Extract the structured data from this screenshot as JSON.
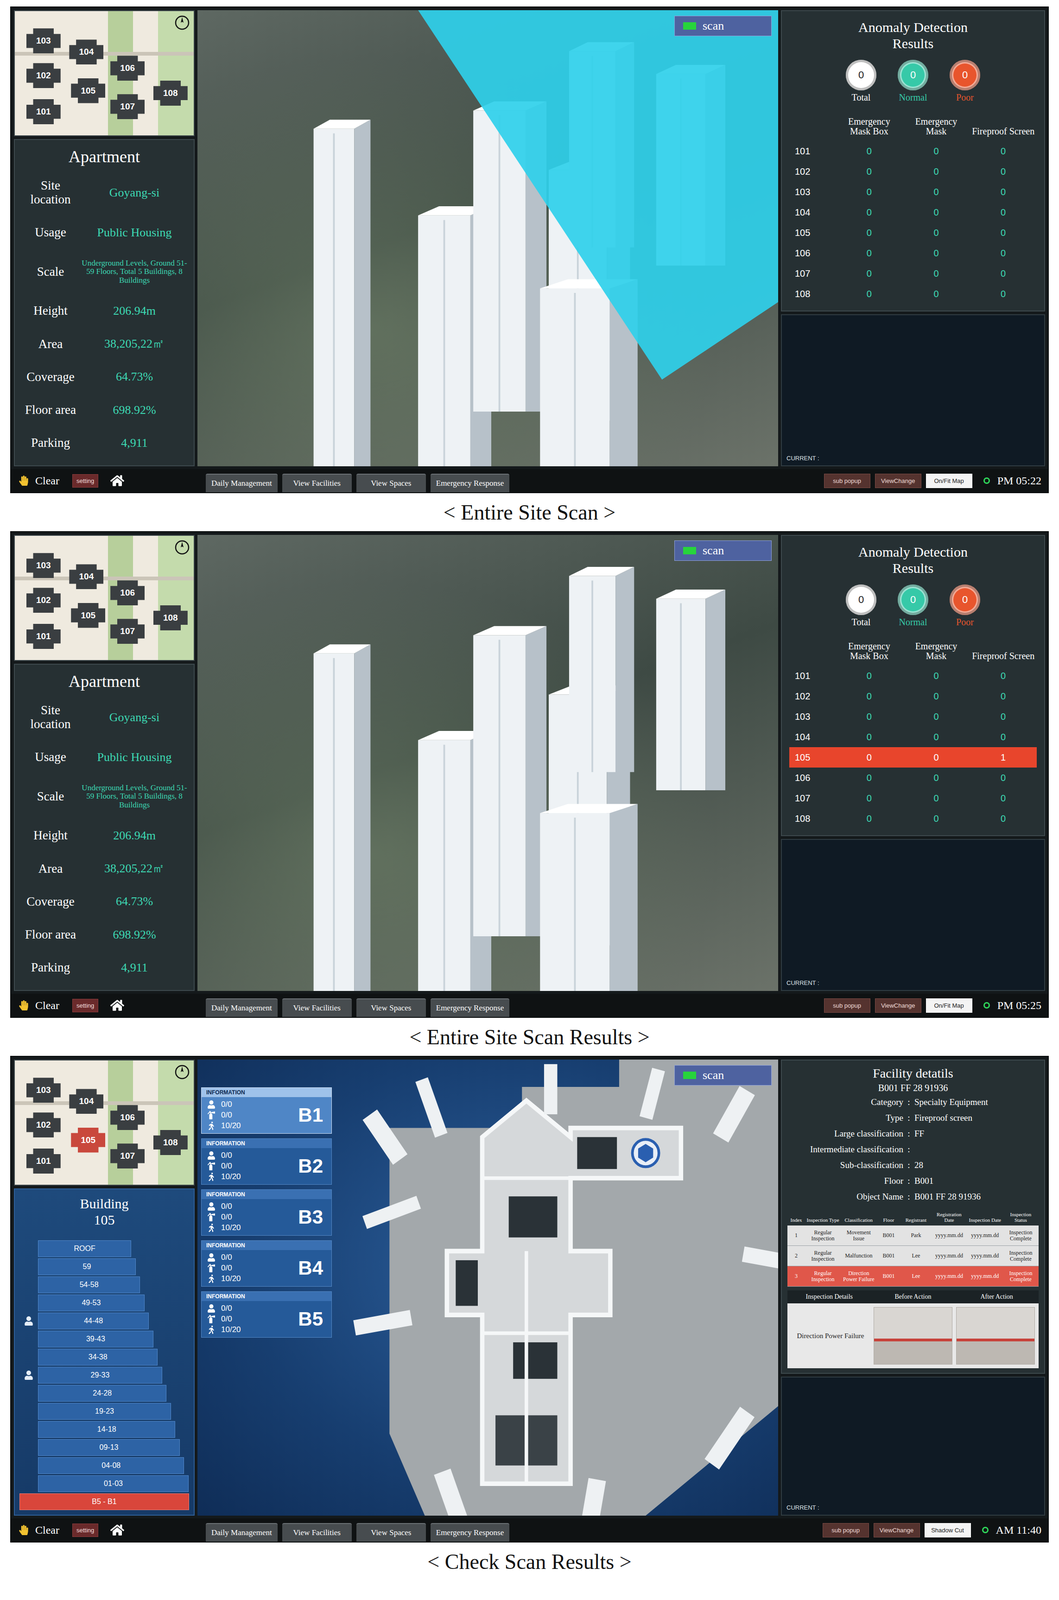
{
  "figure": {
    "panels": [
      {
        "kind": "site",
        "caption": "< Entire Site Scan >",
        "scan_button": "scan",
        "scan_beam": true,
        "minimap": {
          "buildings": [
            {
              "label": "103",
              "selected": false
            },
            {
              "label": "104",
              "selected": false
            },
            {
              "label": "106",
              "selected": false
            },
            {
              "label": "102",
              "selected": false
            },
            {
              "label": "105",
              "selected": false
            },
            {
              "label": "101",
              "selected": false
            },
            {
              "label": "107",
              "selected": false
            },
            {
              "label": "108",
              "selected": false
            }
          ]
        },
        "info": {
          "title": "Apartment",
          "fields": [
            {
              "label": "Site location",
              "value": "Goyang-si"
            },
            {
              "label": "Usage",
              "value": "Public Housing"
            },
            {
              "label": "Scale",
              "value": "Underground Levels, Ground 51-59 Floors, Total 5 Buildings, 8 Buildings"
            },
            {
              "label": "Height",
              "value": "206.94m"
            },
            {
              "label": "Area",
              "value": "38,205,22㎡"
            },
            {
              "label": "Coverage",
              "value": "64.73%"
            },
            {
              "label": "Floor area",
              "value": "698.92%"
            },
            {
              "label": "Parking",
              "value": "4,911"
            }
          ]
        },
        "anomaly": {
          "title": "Anomaly Detection Results",
          "summary": [
            {
              "label": "Total",
              "value": "0",
              "color": "#ffffff"
            },
            {
              "label": "Normal",
              "value": "0",
              "color": "#36c9a8"
            },
            {
              "label": "Poor",
              "value": "0",
              "color": "#e8552d"
            }
          ],
          "columns": [
            "Emergency Mask Box",
            "Emergency Mask",
            "Fireproof Screen"
          ],
          "rows": [
            {
              "building": "101",
              "values": [
                "0",
                "0",
                "0"
              ],
              "selected": false
            },
            {
              "building": "102",
              "values": [
                "0",
                "0",
                "0"
              ],
              "selected": false
            },
            {
              "building": "103",
              "values": [
                "0",
                "0",
                "0"
              ],
              "selected": false
            },
            {
              "building": "104",
              "values": [
                "0",
                "0",
                "0"
              ],
              "selected": false
            },
            {
              "building": "105",
              "values": [
                "0",
                "0",
                "0"
              ],
              "selected": false
            },
            {
              "building": "106",
              "values": [
                "0",
                "0",
                "0"
              ],
              "selected": false
            },
            {
              "building": "107",
              "values": [
                "0",
                "0",
                "0"
              ],
              "selected": false
            },
            {
              "building": "108",
              "values": [
                "0",
                "0",
                "0"
              ],
              "selected": false
            }
          ]
        },
        "current_label": "CURRENT :",
        "toolbar": {
          "clear": "Clear",
          "setting": "setting",
          "tabs": [
            "Daily Management",
            "View Facilities",
            "View Spaces",
            "Emergency Response"
          ],
          "tools": [
            {
              "label": "sub popup",
              "active": false
            },
            {
              "label": "ViewChange",
              "active": false
            },
            {
              "label": "On/Fit Map",
              "active": true
            }
          ],
          "time": "PM 05:22"
        }
      },
      {
        "kind": "site",
        "caption": "< Entire Site Scan Results >",
        "scan_button": "scan",
        "scan_beam": false,
        "minimap": {
          "buildings": [
            {
              "label": "103",
              "selected": false
            },
            {
              "label": "104",
              "selected": false
            },
            {
              "label": "106",
              "selected": false
            },
            {
              "label": "102",
              "selected": false
            },
            {
              "label": "105",
              "selected": false
            },
            {
              "label": "101",
              "selected": false
            },
            {
              "label": "107",
              "selected": false
            },
            {
              "label": "108",
              "selected": false
            }
          ]
        },
        "info": {
          "title": "Apartment",
          "fields": [
            {
              "label": "Site location",
              "value": "Goyang-si"
            },
            {
              "label": "Usage",
              "value": "Public Housing"
            },
            {
              "label": "Scale",
              "value": "Underground Levels, Ground 51-59 Floors, Total 5 Buildings, 8 Buildings"
            },
            {
              "label": "Height",
              "value": "206.94m"
            },
            {
              "label": "Area",
              "value": "38,205,22㎡"
            },
            {
              "label": "Coverage",
              "value": "64.73%"
            },
            {
              "label": "Floor area",
              "value": "698.92%"
            },
            {
              "label": "Parking",
              "value": "4,911"
            }
          ]
        },
        "anomaly": {
          "title": "Anomaly Detection Results",
          "summary": [
            {
              "label": "Total",
              "value": "0",
              "color": "#ffffff"
            },
            {
              "label": "Normal",
              "value": "0",
              "color": "#36c9a8"
            },
            {
              "label": "Poor",
              "value": "0",
              "color": "#e8552d"
            }
          ],
          "columns": [
            "Emergency Mask Box",
            "Emergency Mask",
            "Fireproof Screen"
          ],
          "rows": [
            {
              "building": "101",
              "values": [
                "0",
                "0",
                "0"
              ],
              "selected": false
            },
            {
              "building": "102",
              "values": [
                "0",
                "0",
                "0"
              ],
              "selected": false
            },
            {
              "building": "103",
              "values": [
                "0",
                "0",
                "0"
              ],
              "selected": false
            },
            {
              "building": "104",
              "values": [
                "0",
                "0",
                "0"
              ],
              "selected": false
            },
            {
              "building": "105",
              "values": [
                "0",
                "0",
                "1"
              ],
              "selected": true
            },
            {
              "building": "106",
              "values": [
                "0",
                "0",
                "0"
              ],
              "selected": false
            },
            {
              "building": "107",
              "values": [
                "0",
                "0",
                "0"
              ],
              "selected": false
            },
            {
              "building": "108",
              "values": [
                "0",
                "0",
                "0"
              ],
              "selected": false
            }
          ]
        },
        "current_label": "CURRENT :",
        "toolbar": {
          "clear": "Clear",
          "setting": "setting",
          "tabs": [
            "Daily Management",
            "View Facilities",
            "View Spaces",
            "Emergency Response"
          ],
          "tools": [
            {
              "label": "sub popup",
              "active": false
            },
            {
              "label": "ViewChange",
              "active": false
            },
            {
              "label": "On/Fit Map",
              "active": true
            }
          ],
          "time": "PM 05:25"
        }
      },
      {
        "kind": "building",
        "caption": "< Check Scan Results >",
        "scan_button": "scan",
        "minimap": {
          "buildings": [
            {
              "label": "103",
              "selected": false
            },
            {
              "label": "104",
              "selected": false
            },
            {
              "label": "106",
              "selected": false
            },
            {
              "label": "102",
              "selected": false
            },
            {
              "label": "105",
              "selected": true
            },
            {
              "label": "101",
              "selected": false
            },
            {
              "label": "107",
              "selected": false
            },
            {
              "label": "108",
              "selected": false
            }
          ]
        },
        "building": {
          "title_lines": [
            "Building",
            "105"
          ],
          "floors": [
            {
              "label": "ROOF",
              "selected": false,
              "occupied": false
            },
            {
              "label": "59",
              "selected": false,
              "occupied": false
            },
            {
              "label": "54-58",
              "selected": false,
              "occupied": false
            },
            {
              "label": "49-53",
              "selected": false,
              "occupied": false
            },
            {
              "label": "44-48",
              "selected": false,
              "occupied": true
            },
            {
              "label": "39-43",
              "selected": false,
              "occupied": false
            },
            {
              "label": "34-38",
              "selected": false,
              "occupied": false
            },
            {
              "label": "29-33",
              "selected": false,
              "occupied": true
            },
            {
              "label": "24-28",
              "selected": false,
              "occupied": false
            },
            {
              "label": "19-23",
              "selected": false,
              "occupied": false
            },
            {
              "label": "14-18",
              "selected": false,
              "occupied": false
            },
            {
              "label": "09-13",
              "selected": false,
              "occupied": false
            },
            {
              "label": "04-08",
              "selected": false,
              "occupied": false
            },
            {
              "label": "01-03",
              "selected": false,
              "occupied": false
            },
            {
              "label": "B5 - B1",
              "selected": true,
              "occupied": false
            }
          ]
        },
        "floor_cards": [
          {
            "label": "B1",
            "header": "INFORMATION",
            "stats": [
              "0/0",
              "0/0",
              "10/20"
            ],
            "selected": true
          },
          {
            "label": "B2",
            "header": "INFORMATION",
            "stats": [
              "0/0",
              "0/0",
              "10/20"
            ],
            "selected": false
          },
          {
            "label": "B3",
            "header": "INFORMATION",
            "stats": [
              "0/0",
              "0/0",
              "10/20"
            ],
            "selected": false
          },
          {
            "label": "B4",
            "header": "INFORMATION",
            "stats": [
              "0/0",
              "0/0",
              "10/20"
            ],
            "selected": false
          },
          {
            "label": "B5",
            "header": "INFORMATION",
            "stats": [
              "0/0",
              "0/0",
              "10/20"
            ],
            "selected": false
          }
        ],
        "facility": {
          "title": "Facility detatils",
          "id": "B001 FF 28 91936",
          "separator": ":",
          "fields": [
            {
              "label": "Category",
              "value": "Specialty Equipment"
            },
            {
              "label": "Type",
              "value": "Fireproof screen"
            },
            {
              "label": "Large classification",
              "value": "FF"
            },
            {
              "label": "Intermediate classification",
              "value": ""
            },
            {
              "label": "Sub-classification",
              "value": "28"
            },
            {
              "label": "Floor",
              "value": "B001"
            },
            {
              "label": "Object Name",
              "value": "B001 FF 28 91936"
            }
          ],
          "table": {
            "columns": [
              "Index",
              "Inspection Type",
              "Classification",
              "Floor",
              "Registrant",
              "Registration Date",
              "Inspection Date",
              "Inspection Status"
            ],
            "rows": [
              {
                "cells": [
                  "1",
                  "Regular Inspection",
                  "Movement Issue",
                  "B001",
                  "Park",
                  "yyyy.mm.dd",
                  "yyyy.mm.dd",
                  "Inspection Complete"
                ],
                "selected": false
              },
              {
                "cells": [
                  "2",
                  "Regular Inspection",
                  "Malfunction",
                  "B001",
                  "Lee",
                  "yyyy.mm.dd",
                  "yyyy.mm.dd",
                  "Inspection Complete"
                ],
                "selected": false
              },
              {
                "cells": [
                  "3",
                  "Regular Inspection",
                  "Direction Power Failure",
                  "B001",
                  "Lee",
                  "yyyy.mm.dd",
                  "yyyy.mm.dd",
                  "Inspection Complete"
                ],
                "selected": true
              }
            ]
          },
          "detail": {
            "columns": [
              "Inspection Details",
              "Before Action",
              "After Action"
            ],
            "description": "Direction Power Failure"
          }
        },
        "current_label": "CURRENT :",
        "toolbar": {
          "clear": "Clear",
          "setting": "setting",
          "tabs": [
            "Daily Management",
            "View Facilities",
            "View Spaces",
            "Emergency Response"
          ],
          "tools": [
            {
              "label": "sub popup",
              "active": false
            },
            {
              "label": "ViewChange",
              "active": false
            },
            {
              "label": "Shadow Cut",
              "active": true
            }
          ],
          "time": "AM 11:40"
        }
      }
    ]
  }
}
